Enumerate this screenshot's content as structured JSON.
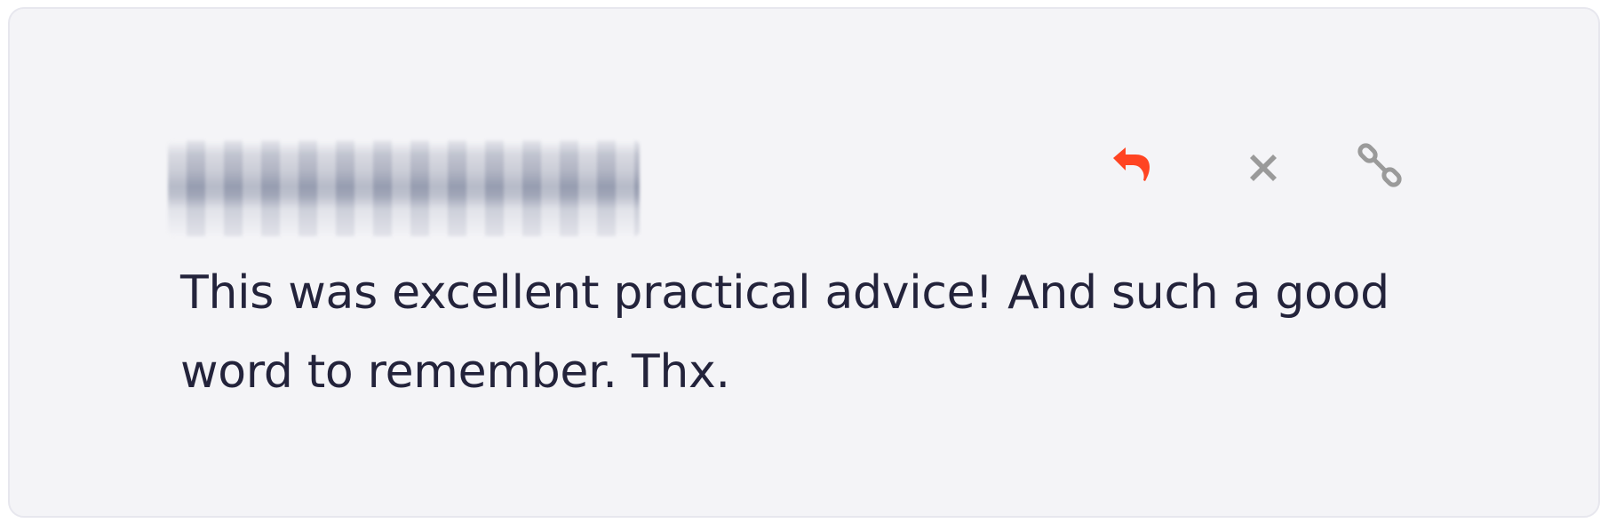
{
  "comment": {
    "author_name": "",
    "text": "This was excellent practical advice! And such a good word to remember. Thx."
  },
  "actions": {
    "reply": {
      "icon": "reply-icon",
      "color": "#ff4422"
    },
    "close": {
      "icon": "close-icon",
      "color": "#9a9a9a"
    },
    "link": {
      "icon": "link-icon",
      "color": "#9a9a9a"
    }
  }
}
